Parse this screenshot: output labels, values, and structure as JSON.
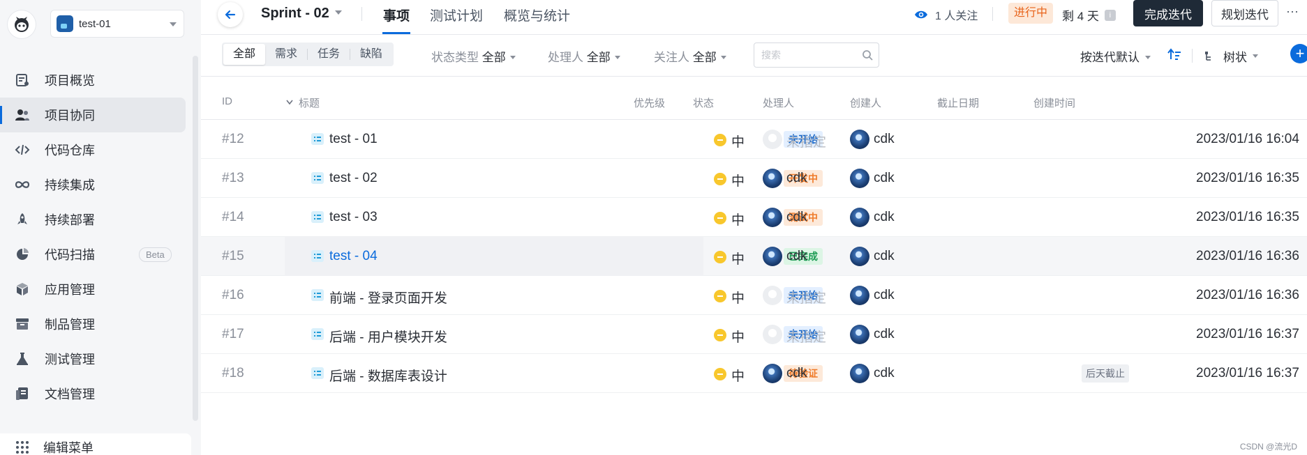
{
  "sidebar": {
    "project_name": "test-01",
    "items": [
      {
        "label": "项目概览",
        "icon": "overview-icon"
      },
      {
        "label": "项目协同",
        "icon": "team-icon",
        "active": true
      },
      {
        "label": "代码仓库",
        "icon": "code-icon"
      },
      {
        "label": "持续集成",
        "icon": "infinity-icon"
      },
      {
        "label": "持续部署",
        "icon": "rocket-icon"
      },
      {
        "label": "代码扫描",
        "icon": "pie-icon",
        "badge": "Beta"
      },
      {
        "label": "应用管理",
        "icon": "cube-icon"
      },
      {
        "label": "制品管理",
        "icon": "box-icon"
      },
      {
        "label": "测试管理",
        "icon": "flask-icon"
      },
      {
        "label": "文档管理",
        "icon": "doc-icon"
      }
    ],
    "edit_menu": "编辑菜单"
  },
  "topbar": {
    "sprint": "Sprint - 02",
    "tabs": [
      "事项",
      "测试计划",
      "概览与统计"
    ],
    "watchers": "1 人关注",
    "status": "进行中",
    "remaining": "剩 4 天",
    "complete_button": "完成迭代",
    "plan_button": "规划迭代",
    "more": "···"
  },
  "filterbar": {
    "segments": [
      "全部",
      "需求",
      "任务",
      "缺陷"
    ],
    "status_type_label": "状态类型",
    "status_type_value": "全部",
    "assignee_label": "处理人",
    "assignee_value": "全部",
    "watcher_label": "关注人",
    "watcher_value": "全部",
    "search_placeholder": "搜索",
    "sort": "按迭代默认",
    "view": "树状",
    "add": "+"
  },
  "table": {
    "headers": [
      "ID",
      "标题",
      "优先级",
      "状态",
      "处理人",
      "创建人",
      "截止日期",
      "创建时间"
    ],
    "rows": [
      {
        "id": "#12",
        "title": "test - 01",
        "priority": "中",
        "status": "未开始",
        "assignee": "未指定",
        "creator": "cdk",
        "due": "",
        "created": "2023/01/16 16:04"
      },
      {
        "id": "#13",
        "title": "test - 02",
        "priority": "中",
        "status": "开发中",
        "assignee": "cdk",
        "creator": "cdk",
        "due": "",
        "created": "2023/01/16 16:35"
      },
      {
        "id": "#14",
        "title": "test - 03",
        "priority": "中",
        "status": "测试中",
        "assignee": "cdk",
        "creator": "cdk",
        "due": "",
        "created": "2023/01/16 16:35"
      },
      {
        "id": "#15",
        "title": "test - 04",
        "priority": "中",
        "status": "已完成",
        "assignee": "cdk",
        "creator": "cdk",
        "due": "",
        "created": "2023/01/16 16:36"
      },
      {
        "id": "#16",
        "title": "前端 - 登录页面开发",
        "priority": "中",
        "status": "未开始",
        "assignee": "未指定",
        "creator": "cdk",
        "due": "",
        "created": "2023/01/16 16:36"
      },
      {
        "id": "#17",
        "title": "后端 - 用户模块开发",
        "priority": "中",
        "status": "未开始",
        "assignee": "未指定",
        "creator": "cdk",
        "due": "",
        "created": "2023/01/16 16:37"
      },
      {
        "id": "#18",
        "title": "后端 - 数据库表设计",
        "priority": "中",
        "status": "待验证",
        "assignee": "cdk",
        "creator": "cdk",
        "due": "后天截止",
        "created": "2023/01/16 16:37"
      }
    ]
  },
  "status_colors": {
    "未开始": {
      "bg": "#e3efff",
      "fg": "#1565c8"
    },
    "开发中": {
      "bg": "#fde9d9",
      "fg": "#ef7b2a"
    },
    "测试中": {
      "bg": "#fde9d9",
      "fg": "#ef7b2a"
    },
    "已完成": {
      "bg": "#dcf5e5",
      "fg": "#1a9a52"
    },
    "待验证": {
      "bg": "#fde9d9",
      "fg": "#ef7b2a"
    }
  },
  "watermark": "CSDN @流光D"
}
